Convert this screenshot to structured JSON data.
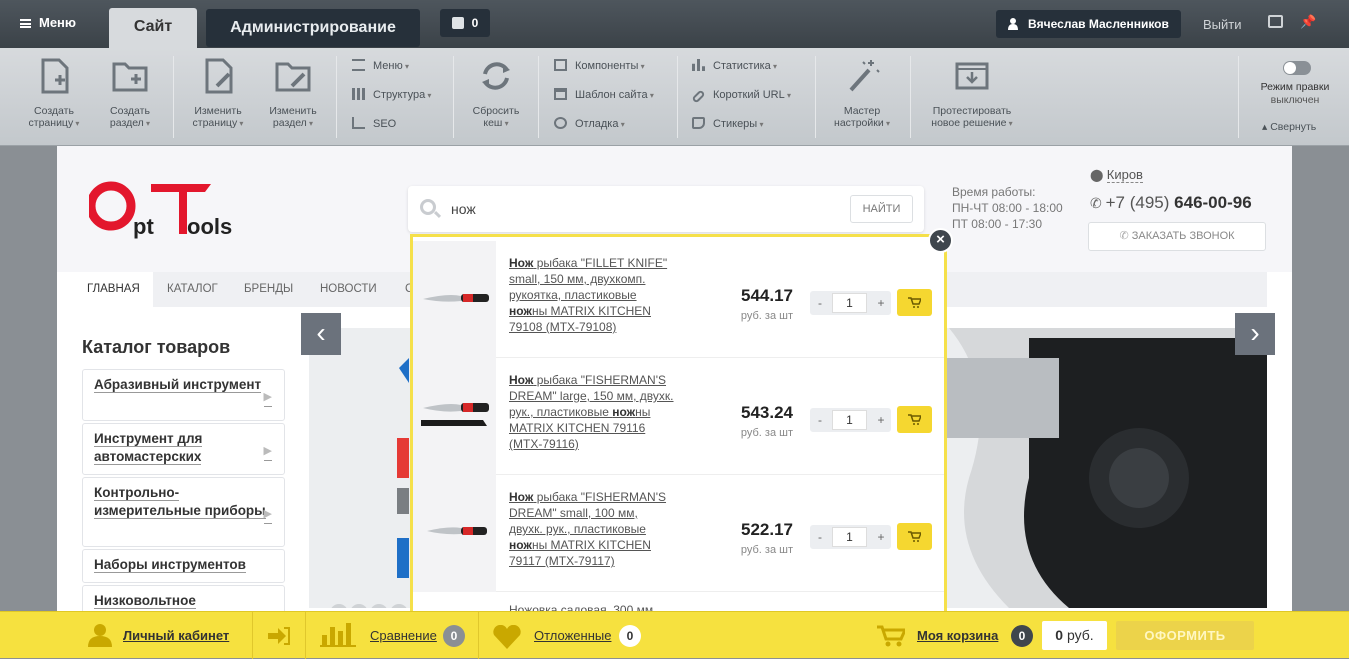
{
  "admin_bar": {
    "menu_label": "Меню",
    "tab_site": "Сайт",
    "tab_admin": "Администрирование",
    "notifications_count": "0",
    "user_name": "Вячеслав Масленников",
    "logout": "Выйти"
  },
  "toolbar": {
    "create_page": [
      "Создать",
      "страницу"
    ],
    "create_section": [
      "Создать",
      "раздел"
    ],
    "edit_page": [
      "Изменить",
      "страницу"
    ],
    "edit_section": [
      "Изменить",
      "раздел"
    ],
    "menu": "Меню",
    "structure": "Структура",
    "seo": "SEO",
    "clear_cache": [
      "Сбросить",
      "кеш"
    ],
    "components": "Компоненты",
    "site_template": "Шаблон сайта",
    "debug": "Отладка",
    "statistics": "Статистика",
    "short_url": "Короткий URL",
    "stickers": "Стикеры",
    "wizard": [
      "Мастер",
      "настройки"
    ],
    "test_solution": [
      "Протестировать",
      "новое решение"
    ],
    "edit_mode_label": "Режим правки",
    "edit_mode_state": "выключен",
    "collapse": "Свернуть"
  },
  "header": {
    "logo_text": "OptTools",
    "search_value": "нож",
    "search_button": "НАЙТИ",
    "hours_title": "Время работы:",
    "hours_1": "ПН-ЧТ 08:00 - 18:00",
    "hours_2": "ПТ 08:00 - 17:30",
    "city": "Киров",
    "phone_prefix": "+7 (495)",
    "phone_number": "646-00-96",
    "callback": "ЗАКАЗАТЬ ЗВОНОК"
  },
  "nav": [
    "ГЛАВНАЯ",
    "КАТАЛОГ",
    "БРЕНДЫ",
    "НОВОСТИ",
    "С"
  ],
  "catalog": {
    "title": "Каталог товаров",
    "items": [
      {
        "label": "Абразивный инструмент"
      },
      {
        "label": "Инструмент для автомастерских"
      },
      {
        "label": "Контрольно-измерительные приборы"
      },
      {
        "label": "Наборы инструментов"
      },
      {
        "label": "Низковольтное"
      }
    ]
  },
  "search_results": [
    {
      "name_bold": "Нож",
      "name": " рыбака \"FILLET KNIFE\" small, 150 мм, двухкомп. рукоятка, пластиковые ",
      "name_bold2": "нож",
      "name_tail": "ны MATRIX KITCHEN 79108 (MTX-79108)",
      "price": "544.17",
      "unit": "руб. за шт",
      "qty": "1"
    },
    {
      "name_bold": "Нож",
      "name": " рыбака \"FISHERMAN'S DREAM\" large, 150 мм, двухк. рук., пластиковые ",
      "name_bold2": "нож",
      "name_tail": "ны MATRIX KITCHEN 79116 (MTX-79116)",
      "price": "543.24",
      "unit": "руб. за шт",
      "qty": "1"
    },
    {
      "name_bold": "Нож",
      "name": " рыбака \"FISHERMAN'S DREAM\" small, 100 мм, двухк. рук., пластиковые ",
      "name_bold2": "нож",
      "name_tail": "ны MATRIX KITCHEN 79117 (MTX-79117)",
      "price": "522.17",
      "unit": "руб. за шт",
      "qty": "1"
    }
  ],
  "search_peek": "Ножовка садовая, 300 мм",
  "bottom_bar": {
    "account": "Личный кабинет",
    "compare": "Сравнение",
    "compare_count": "0",
    "deferred": "Отложенные",
    "deferred_count": "0",
    "cart": "Моя корзина",
    "cart_count": "0",
    "sum_value": "0",
    "sum_currency": "руб.",
    "checkout": "ОФОРМИТЬ"
  },
  "colors": {
    "accent_yellow": "#f6e13f",
    "admin_dark": "#26303a",
    "logo_red": "#e3172d"
  }
}
